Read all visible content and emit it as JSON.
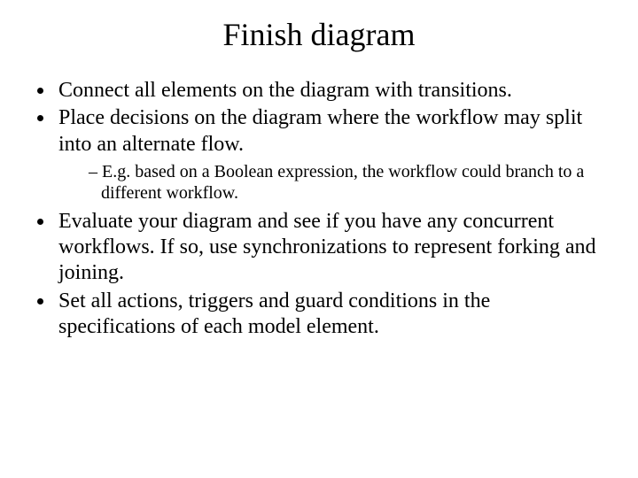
{
  "title": "Finish diagram",
  "bullets": {
    "b1": "Connect all elements on the diagram with transitions.",
    "b2": "Place decisions on the diagram where the workflow may split into an alternate flow.",
    "b2_sub1": "E.g. based on a Boolean expression, the workflow could branch to a different workflow.",
    "b3": "Evaluate your diagram and see if you have any concurrent workflows.  If so, use synchronizations to represent forking and joining.",
    "b4": "Set all actions, triggers and guard conditions in the specifications of each model element."
  }
}
